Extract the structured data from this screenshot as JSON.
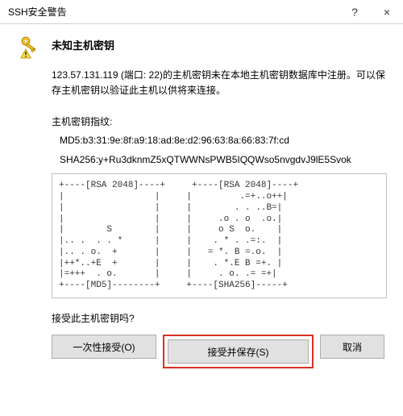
{
  "titlebar": {
    "title": "SSH安全警告",
    "help_glyph": "?",
    "close_glyph": "×"
  },
  "dialog": {
    "heading": "未知主机密钥",
    "message": "123.57.131.119 (端口: 22)的主机密钥未在本地主机密钥数据库中注册。可以保存主机密钥以验证此主机以供将来连接。",
    "fingerprint_label": "主机密钥指纹:",
    "md5": "MD5:b3:31:9e:8f:a9:18:ad:8e:d2:96:63:8a:66:83:7f:cd",
    "sha256": "SHA256:y+Ru3dknmZ5xQTWWNsPWB5IQQWso5nvgdvJ9lE5Svok",
    "ascii_art": "+----[RSA 2048]----+     +----[RSA 2048]----+\n|                 |     |         .=+..o++|\n|                 |     |        . . ..B=|\n|                 |     |     .o . o  .o.|\n|        S        |     |     o S  o.    |\n|.. .  . . *      |     |    . * . .=:.  |\n|.. . o.  +       |     |   = *. B =.o.  |\n|++*..+E  +       |     |    . *.E B =+. |\n|=+++  . o.       |     |     . o. .= =+|\n+----[MD5]--------+     +----[SHA256]-----+",
    "prompt": "接受此主机密钥吗?",
    "buttons": {
      "once": "一次性接受(O)",
      "save": "接受并保存(S)",
      "cancel": "取消"
    }
  }
}
